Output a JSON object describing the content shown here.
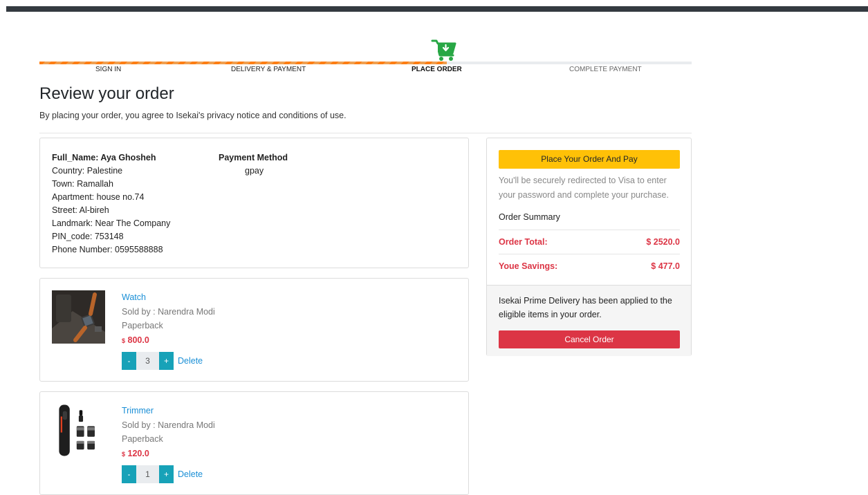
{
  "progress": {
    "fraction": 0.625,
    "steps": [
      {
        "label": "SIGN IN"
      },
      {
        "label": "DELIVERY & PAYMENT"
      },
      {
        "label": "PLACE ORDER"
      },
      {
        "label": "COMPLETE PAYMENT"
      }
    ],
    "icon": "cart-download-icon",
    "color": "#fd7e14",
    "icon_color": "#28a745"
  },
  "header": {
    "title": "Review your order",
    "subtitle": "By placing your order, you agree to Isekai's privacy notice and conditions of use."
  },
  "address": {
    "full_name": "Full_Name: Aya Ghosheh",
    "country": "Country: Palestine",
    "town": "Town: Ramallah",
    "apartment": "Apartment: house no.74",
    "street": "Street: Al-bireh",
    "landmark": "Landmark: Near The Company",
    "pin": "PIN_code: 753148",
    "phone": "Phone Number: 0595588888"
  },
  "payment": {
    "title": "Payment Method",
    "method": "gpay"
  },
  "items": [
    {
      "name": "Watch",
      "sold_by": "Sold by : Narendra Modi",
      "format": "Paperback",
      "currency": "$",
      "price": "800.0",
      "qty_minus": "-",
      "qty": "3",
      "qty_plus": "+",
      "delete": "Delete"
    },
    {
      "name": "Trimmer",
      "sold_by": "Sold by : Narendra Modi",
      "format": "Paperback",
      "currency": "$",
      "price": "120.0",
      "qty_minus": "-",
      "qty": "1",
      "qty_plus": "+",
      "delete": "Delete"
    }
  ],
  "summary": {
    "place_order_label": "Place Your Order And Pay",
    "redirect_note": "You'll be securely redirected to Visa to enter your password and complete your purchase.",
    "heading": "Order Summary",
    "order_total_label": "Order Total:",
    "order_total_value": "$ 2520.0",
    "savings_label": "Youe Savings:",
    "savings_value": "$ 477.0",
    "prime_note": "Isekai Prime Delivery has been applied to the eligible items in your order.",
    "cancel_label": "Cancel Order"
  },
  "colors": {
    "accent_teal": "#17a2b8",
    "place_btn": "#ffc107",
    "cancel_btn": "#dc3545",
    "link": "#1a8fd6"
  }
}
